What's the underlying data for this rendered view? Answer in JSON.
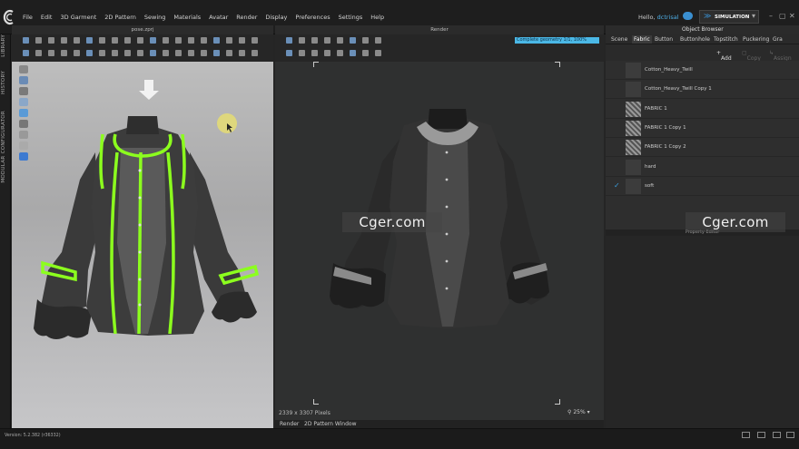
{
  "menubar": {
    "items": [
      "File",
      "Edit",
      "3D Garment",
      "2D Pattern",
      "Sewing",
      "Materials",
      "Avatar",
      "Render",
      "Display",
      "Preferences",
      "Settings",
      "Help"
    ],
    "greeting": "Hello,",
    "username": "dctrisal",
    "simulation_label": "SIMULATION"
  },
  "left_strip": {
    "tabs": [
      "LIBRARY",
      "HISTORY",
      "MODULAR CONFIGURATOR"
    ]
  },
  "viewport3d": {
    "title": "pose.zprj"
  },
  "render": {
    "title": "Render",
    "progress_text": "Complete geometry 1/1, 100%",
    "progress_value": 1.0,
    "pixels_label": "2339 x 3307 Pixels",
    "zoom_label": "25%",
    "bottom_tabs": [
      "Render",
      "2D Pattern Window"
    ]
  },
  "object_browser": {
    "title": "Object Browser",
    "tabs": [
      "Scene",
      "Fabric",
      "Button",
      "Buttonhole",
      "Topstitch",
      "Puckering",
      "Gra"
    ],
    "active_tab": "Fabric",
    "add_label": "Add",
    "copy_label": "Copy",
    "assign_label": "Assign",
    "items": [
      {
        "name": "Cotton_Heavy_Twill",
        "checked": false
      },
      {
        "name": "Cotton_Heavy_Twill Copy 1",
        "checked": false
      },
      {
        "name": "FABRIC 1",
        "checked": false
      },
      {
        "name": "FABRIC 1 Copy 1",
        "checked": false
      },
      {
        "name": "FABRIC 1 Copy 2",
        "checked": false
      },
      {
        "name": "hard",
        "checked": false
      },
      {
        "name": "soft",
        "checked": true
      }
    ],
    "property_editor_label": "Property Editor"
  },
  "watermark": "Cger.com",
  "status": {
    "version": "Version: 5.2.382 (r36332)"
  },
  "colors": {
    "accent": "#3ba0e0",
    "highlight": "#8cff1e",
    "progress": "#4bb8e6"
  },
  "icons": [
    "clo-logo-icon",
    "cloud-icon",
    "simulation-icon",
    "minimize-icon",
    "maximize-icon",
    "close-icon",
    "checkmark-icon",
    "add-icon",
    "copy-icon",
    "assign-icon",
    "zoom-icon",
    "down-arrow-icon"
  ]
}
